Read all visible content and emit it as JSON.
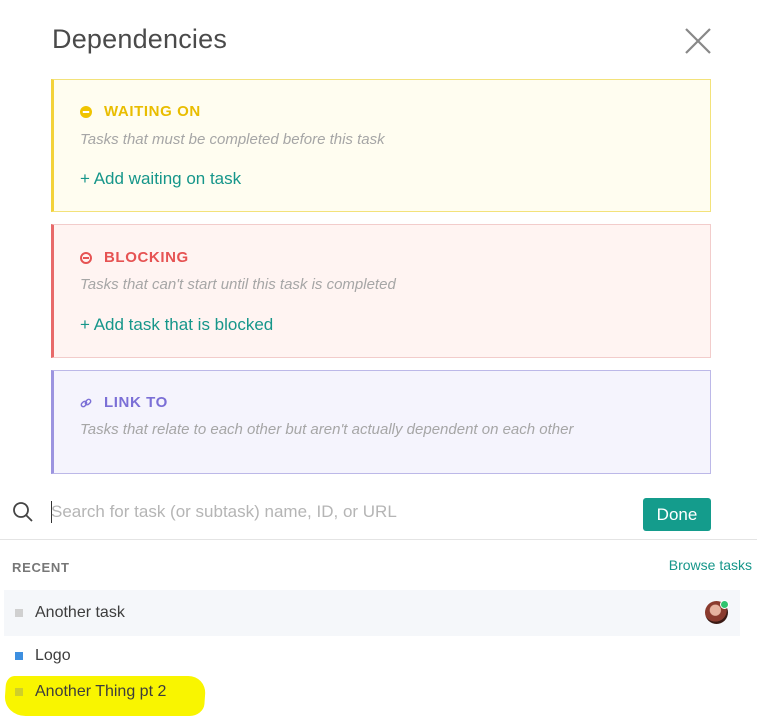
{
  "dialog": {
    "title": "Dependencies"
  },
  "waiting_on": {
    "heading": "WAITING ON",
    "description": "Tasks that must be completed before this task",
    "add_label": "+ Add waiting on task",
    "color": "#e9bd00"
  },
  "blocking": {
    "heading": "BLOCKING",
    "description": "Tasks that can't start until this task is completed",
    "add_label": "+ Add task that is blocked",
    "color": "#e65353"
  },
  "link_to": {
    "heading": "LINK TO",
    "description": "Tasks that relate to each other but aren't actually dependent on each other",
    "color": "#7b6fd6"
  },
  "search": {
    "placeholder": "Search for task (or subtask) name, ID, or URL",
    "value": ""
  },
  "done_label": "Done",
  "recent": {
    "label": "RECENT",
    "browse_label": "Browse tasks",
    "tasks": [
      {
        "name": "Another task",
        "status_color": "#d0d0d0",
        "has_avatar": true
      },
      {
        "name": "Logo",
        "status_color": "#3d8fe0",
        "has_avatar": false
      },
      {
        "name": "Another Thing pt 2",
        "status_color": "#cfcf2a",
        "has_avatar": false,
        "highlighted": true
      }
    ]
  },
  "accent_color": "#149c8c"
}
